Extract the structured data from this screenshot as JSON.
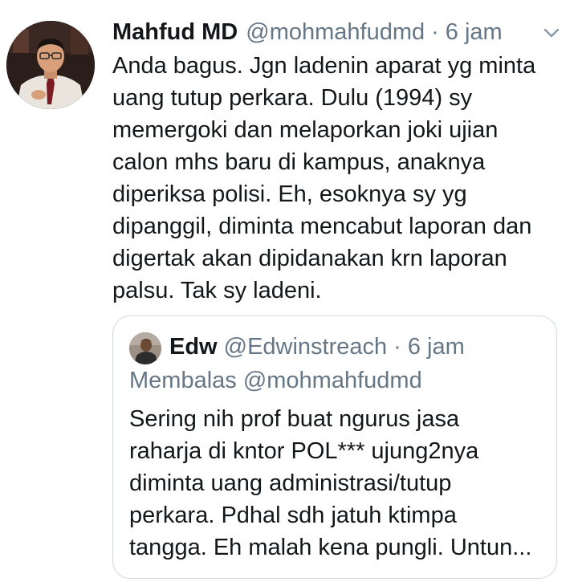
{
  "tweet": {
    "author_name": "Mahfud MD",
    "author_handle": "@mohmahfudmd",
    "separator": "·",
    "time": "6 jam",
    "body_lines": [
      "Anda bagus. Jgn ladenin aparat yg minta",
      "uang tutup perkara. Dulu (1994) sy",
      "memergoki dan melaporkan joki ujian",
      "calon mhs baru di kampus, anaknya",
      "diperiksa polisi. Eh, esoknya sy yg",
      "dipanggil, diminta mencabut laporan dan",
      "digertak akan dipidanakan krn laporan",
      "palsu. Tak sy ladeni."
    ],
    "menu_icon": "chevron-down-icon"
  },
  "quoted": {
    "author_name": "Edw",
    "author_handle": "@Edwinstreach",
    "separator": "·",
    "time": "6 jam",
    "replying_to": "Membalas @mohmahfudmd",
    "body_lines": [
      "Sering nih prof buat ngurus jasa",
      "raharja di kntor POL*** ujung2nya",
      "diminta uang administrasi/tutup",
      "perkara. Pdhal sdh jatuh ktimpa",
      "tangga. Eh malah kena pungli. Untun..."
    ]
  },
  "colors": {
    "text_primary": "#14171a",
    "text_secondary": "#657786",
    "border": "#cfd9de",
    "background": "#ffffff"
  }
}
